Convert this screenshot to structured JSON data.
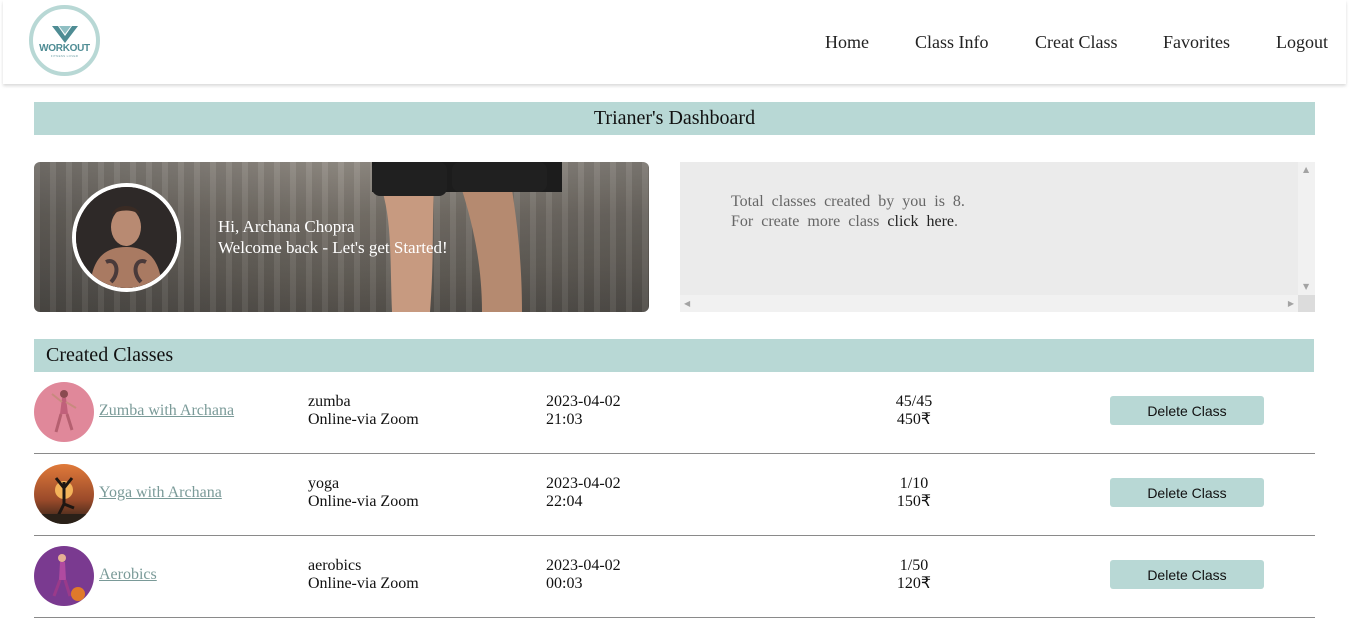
{
  "navbar": {
    "logo": {
      "title": "WORKOUT",
      "subtitle": "FITNESS LOVER"
    },
    "links": [
      "Home",
      "Class Info",
      "Creat Class",
      "Favorites",
      "Logout"
    ]
  },
  "dashboard": {
    "title": "Trianer's Dashboard",
    "greeting": "Hi, Archana Chopra",
    "welcome": "Welcome back - Let's get Started!",
    "info_line1": "Total classes created by you is 8.",
    "info_line2_prefix": "For create more class ",
    "info_line2_link": "click here",
    "info_line2_suffix": "."
  },
  "classes": {
    "header": "Created Classes",
    "delete_label": "Delete Class",
    "rows": [
      {
        "name": "Zumba with Archana",
        "type": "zumba",
        "mode": "Online-via Zoom",
        "date": "2023-04-02",
        "time": "21:03",
        "seats": "45/45",
        "price": "450₹"
      },
      {
        "name": "Yoga with Archana",
        "type": "yoga",
        "mode": "Online-via Zoom",
        "date": "2023-04-02",
        "time": "22:04",
        "seats": "1/10",
        "price": "150₹"
      },
      {
        "name": "Aerobics",
        "type": "aerobics",
        "mode": "Online-via Zoom",
        "date": "2023-04-02",
        "time": "00:03",
        "seats": "1/50",
        "price": "120₹"
      }
    ]
  },
  "colors": {
    "accent": "#b8d8d5",
    "link": "#7a9a98"
  }
}
